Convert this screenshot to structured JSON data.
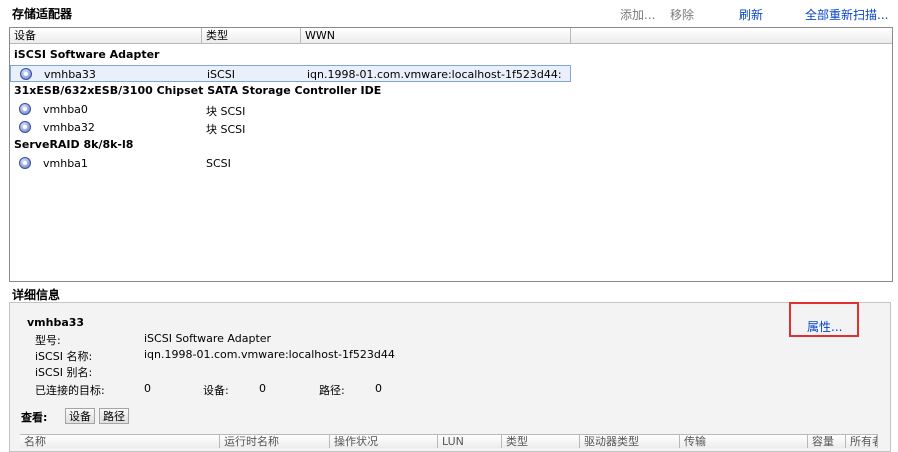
{
  "header": {
    "title": "存储适配器",
    "add_label": "添加...",
    "remove_label": "移除",
    "refresh_label": "刷新",
    "rescan_label": "全部重新扫描..."
  },
  "table": {
    "columns": [
      "设备",
      "类型",
      "WWN"
    ],
    "groups": [
      {
        "name": "iSCSI Software Adapter",
        "rows": [
          {
            "device": "vmhba33",
            "type": "iSCSI",
            "wwn": "iqn.1998-01.com.vmware:localhost-1f523d44:",
            "icon": "adapter-icon"
          }
        ]
      },
      {
        "name": "31xESB/632xESB/3100 Chipset SATA Storage Controller IDE",
        "rows": [
          {
            "device": "vmhba0",
            "type": "块 SCSI",
            "wwn": "",
            "icon": "adapter-icon"
          },
          {
            "device": "vmhba32",
            "type": "块 SCSI",
            "wwn": "",
            "icon": "adapter-icon"
          }
        ]
      },
      {
        "name": "ServeRAID 8k/8k-l8",
        "rows": [
          {
            "device": "vmhba1",
            "type": "SCSI",
            "wwn": "",
            "icon": "adapter-icon"
          }
        ]
      }
    ]
  },
  "details": {
    "title": "详细信息",
    "adapter_name": "vmhba33",
    "properties_label": "属性...",
    "model_label": "型号:",
    "model_value": "iSCSI Software Adapter",
    "iscsi_name_label": "iSCSI 名称:",
    "iscsi_name_value": "iqn.1998-01.com.vmware:localhost-1f523d44",
    "iscsi_alias_label": "iSCSI 别名:",
    "iscsi_alias_value": "",
    "connected_targets_label": "已连接的目标:",
    "connected_targets_value": "0",
    "devices_label": "设备:",
    "devices_value": "0",
    "paths_label": "路径:",
    "paths_value": "0",
    "view_label": "查看:",
    "view_devices_button": "设备",
    "view_paths_button": "路径"
  },
  "bottom_table": {
    "columns": [
      "名称",
      "运行时名称",
      "操作状况",
      "LUN",
      "类型",
      "驱动器类型",
      "传输",
      "容量",
      "所有者"
    ]
  }
}
